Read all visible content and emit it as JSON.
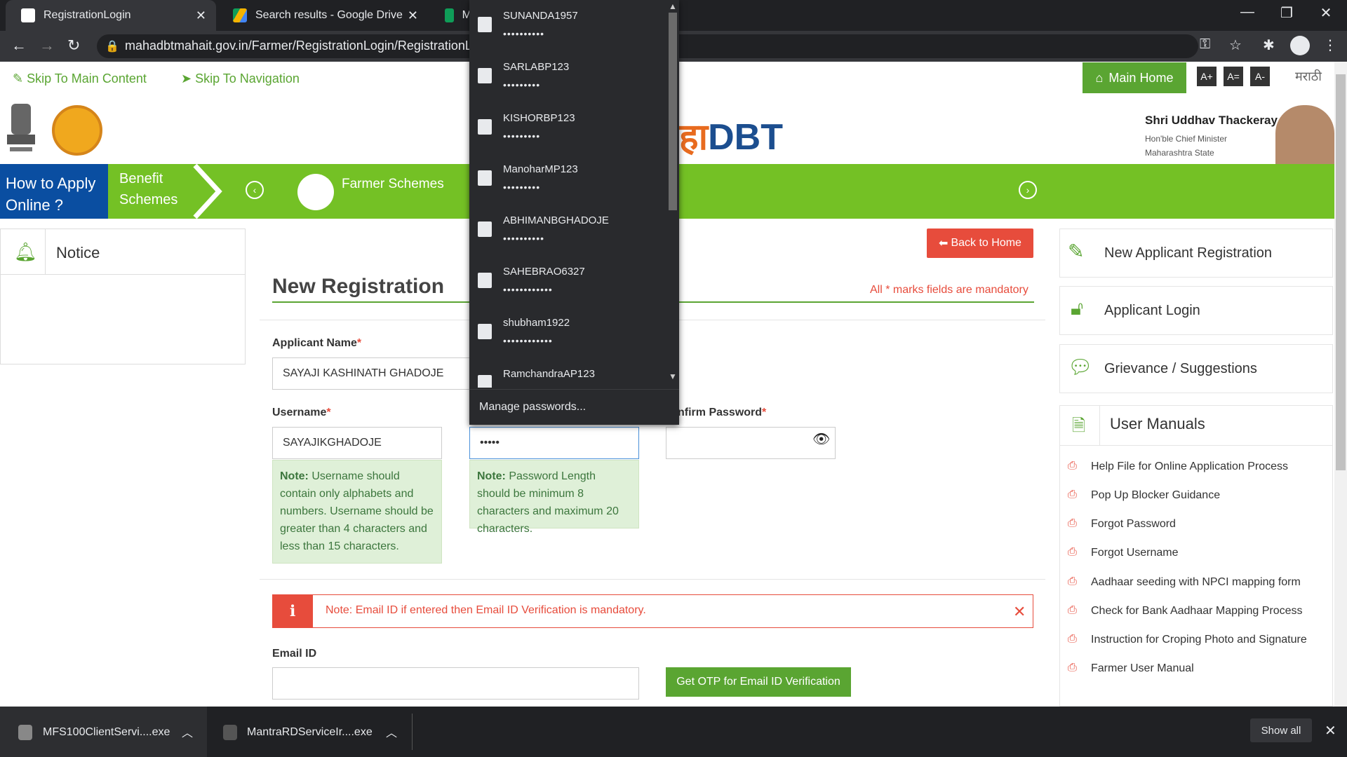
{
  "browser": {
    "tabs": [
      {
        "title": "RegistrationLogin",
        "active": true
      },
      {
        "title": "Search results - Google Drive",
        "active": false
      },
      {
        "title": "M",
        "active": false
      }
    ],
    "url": "mahadbtmahait.gov.in/Farmer/RegistrationLogin/RegistrationLo"
  },
  "access_bar": {
    "skip_main": "Skip To Main Content",
    "skip_nav": "Skip To Navigation",
    "main_home": "Main Home",
    "font_plus": "A+",
    "font_equal": "A=",
    "font_minus": "A-",
    "language": "मराठी"
  },
  "header": {
    "logo_text_1": "हा",
    "logo_text_2": "DBT",
    "cm_name": "Shri Uddhav Thackeray",
    "cm_title": "Hon'ble Chief Minister",
    "cm_state": "Maharashtra State"
  },
  "band": {
    "how_to": "How to Apply Online ?",
    "benefit": "Benefit Schemes",
    "farmer": "Farmer Schemes"
  },
  "notice": {
    "title": "Notice"
  },
  "form": {
    "back_home": "Back to Home",
    "title": "New Registration",
    "mandatory_note": "All * marks fields are mandatory",
    "applicant_name_label": "Applicant Name",
    "applicant_name_value": "SAYAJI KASHINATH GHADOJE",
    "username_label": "Username",
    "username_value": "SAYAJIKGHADOJE",
    "password_value": "•••••",
    "confirm_password_label": "nfirm Password",
    "username_note_bold": "Note:",
    "username_note": "Username should contain only alphabets and numbers. Username should be greater than 4 characters and less than 15 characters.",
    "password_note_bold": "Note:",
    "password_note": "Password Length should be minimum 8 characters and maximum 20 characters.",
    "email_alert": "Note: Email ID if entered then Email ID Verification is mandatory.",
    "email_label": "Email ID",
    "otp_button": "Get OTP for Email ID Verification",
    "required_mark": "*"
  },
  "right_panel": {
    "new_applicant": "New Applicant Registration",
    "applicant_login": "Applicant Login",
    "grievance": "Grievance / Suggestions",
    "manuals_title": "User Manuals",
    "manuals": [
      "Help File for Online Application Process",
      "Pop Up Blocker Guidance",
      "Forgot Password",
      "Forgot Username",
      "Aadhaar seeding with NPCI mapping form",
      "Check for Bank Aadhaar Mapping Process",
      "Instruction for Croping Photo and Signature",
      "Farmer User Manual"
    ]
  },
  "password_dropdown": {
    "items": [
      {
        "username": "SUNANDA1957",
        "dots": "••••••••••"
      },
      {
        "username": "SARLABP123",
        "dots": "•••••••••"
      },
      {
        "username": "KISHORBP123",
        "dots": "•••••••••"
      },
      {
        "username": "ManoharMP123",
        "dots": "•••••••••"
      },
      {
        "username": "ABHIMANBGHADOJE",
        "dots": "••••••••••"
      },
      {
        "username": "SAHEBRAO6327",
        "dots": "••••••••••••"
      },
      {
        "username": "shubham1922",
        "dots": "••••••••••••"
      },
      {
        "username": "RamchandraAP123",
        "dots": ""
      }
    ],
    "manage": "Manage passwords..."
  },
  "downloads": {
    "items": [
      "MFS100ClientServi....exe",
      "MantraRDServiceIr....exe"
    ],
    "show_all": "Show all"
  },
  "colors": {
    "brand_green": "#74c125",
    "accent_green": "#5aa532",
    "alert_red": "#e74c3c",
    "nav_blue": "#0a4ea1"
  }
}
